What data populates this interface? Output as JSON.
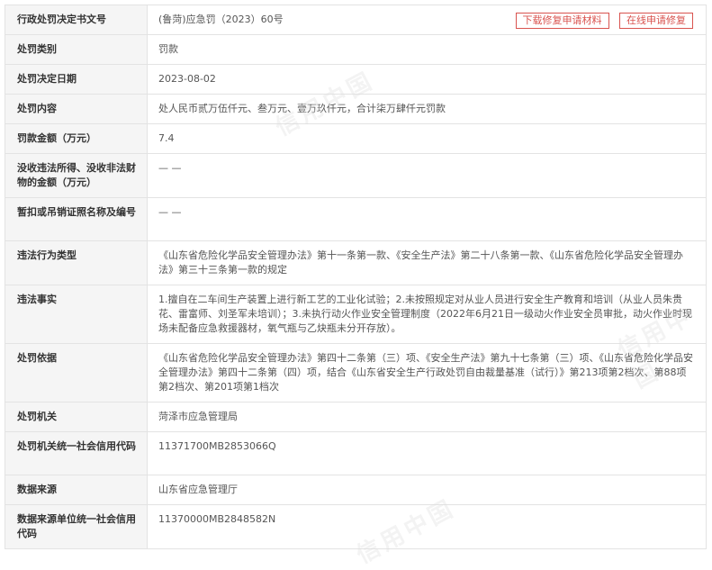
{
  "actions": {
    "download_label": "下载修复申请材料",
    "online_label": "在线申请修复"
  },
  "watermark": "信用中国",
  "rows": [
    {
      "label": "行政处罚决定书文号",
      "value": "(鲁菏)应急罚（2023）60号"
    },
    {
      "label": "处罚类别",
      "value": "罚款"
    },
    {
      "label": "处罚决定日期",
      "value": "2023-08-02"
    },
    {
      "label": "处罚内容",
      "value": "处人民币贰万伍仟元、叁万元、壹万玖仟元，合计柒万肆仟元罚款"
    },
    {
      "label": "罚款金额（万元）",
      "value": "7.4"
    },
    {
      "label": "没收违法所得、没收非法财物的金额（万元）",
      "value": "— —"
    },
    {
      "label": "暂扣或吊销证照名称及编号",
      "value": "— —"
    },
    {
      "label": "违法行为类型",
      "value": "《山东省危险化学品安全管理办法》第十一条第一款、《安全生产法》第二十八条第一款、《山东省危险化学品安全管理办法》第三十三条第一款的规定"
    },
    {
      "label": "违法事实",
      "value": "1.擅自在二车间生产装置上进行新工艺的工业化试验；2.未按照规定对从业人员进行安全生产教育和培训（从业人员朱贵花、雷富师、刘圣军未培训）；3.未执行动火作业安全管理制度（2022年6月21日一级动火作业安全员审批，动火作业时现场未配备应急救援器材，氧气瓶与乙炔瓶未分开存放）。"
    },
    {
      "label": "处罚依据",
      "value": "《山东省危险化学品安全管理办法》第四十二条第（三）项、《安全生产法》第九十七条第（三）项、《山东省危险化学品安全管理办法》第四十二条第（四）项，结合《山东省安全生产行政处罚自由裁量基准（试行）》第213项第2档次、第88项第2档次、第201项第1档次"
    },
    {
      "label": "处罚机关",
      "value": "菏泽市应急管理局"
    },
    {
      "label": "处罚机关统一社会信用代码",
      "value": "11371700MB2853066Q"
    },
    {
      "label": "数据来源",
      "value": "山东省应急管理厅"
    },
    {
      "label": "数据来源单位统一社会信用代码",
      "value": "11370000MB2848582N"
    }
  ]
}
